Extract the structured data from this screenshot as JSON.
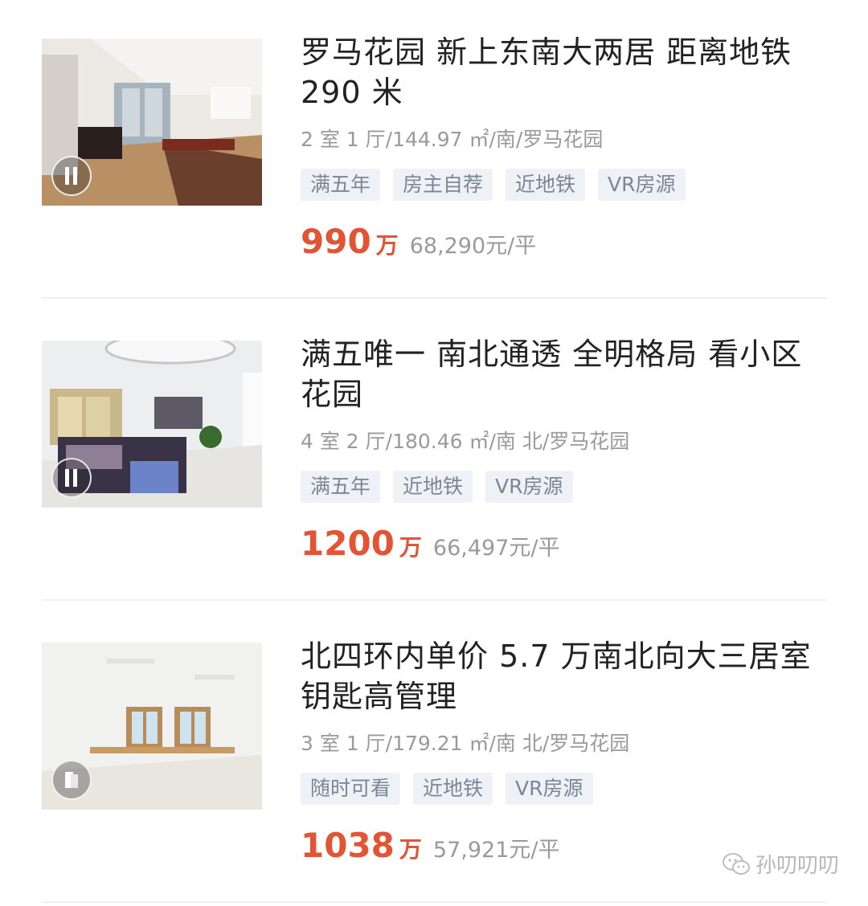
{
  "listings": [
    {
      "title": "罗马花园 新上东南大两居 距离地铁 290 米",
      "meta": "2 室 1 厅/144.97 ㎡/南/罗马花园",
      "tags": [
        "满五年",
        "房主自荐",
        "近地铁",
        "VR房源"
      ],
      "price": "990",
      "price_unit": "万",
      "unit_price": "68,290元/平"
    },
    {
      "title": "满五唯一 南北通透 全明格局 看小区花园",
      "meta": "4 室 2 厅/180.46 ㎡/南 北/罗马花园",
      "tags": [
        "满五年",
        "近地铁",
        "VR房源"
      ],
      "price": "1200",
      "price_unit": "万",
      "unit_price": "66,497元/平"
    },
    {
      "title": "北四环内单价 5.7 万南北向大三居室钥匙高管理",
      "meta": "3 室 1 厅/179.21 ㎡/南 北/罗马花园",
      "tags": [
        "随时可看",
        "近地铁",
        "VR房源"
      ],
      "price": "1038",
      "price_unit": "万",
      "unit_price": "57,921元/平"
    }
  ],
  "watermark": {
    "text": "孙叨叨叨",
    "icon": "wechat-icon"
  },
  "colors": {
    "price": "#e35434",
    "tag_bg": "#eef1f5",
    "tag_text": "#7b8796",
    "meta": "#9a9a9a"
  }
}
